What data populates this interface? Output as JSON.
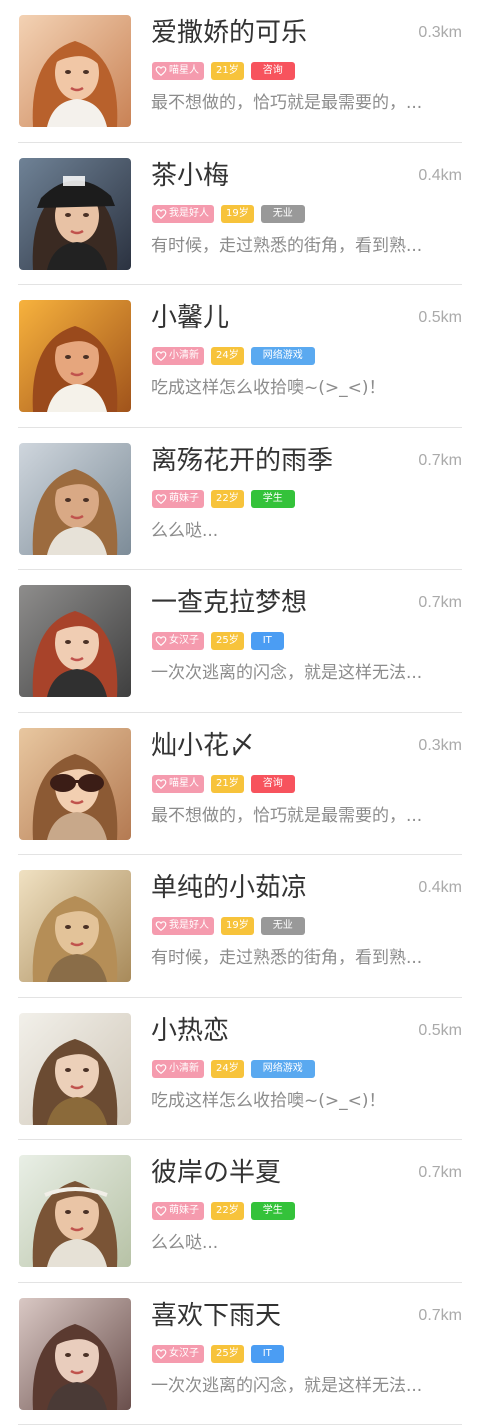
{
  "colors": {
    "persona_tag": "#f59bae",
    "age_tag": "#f7c33b",
    "name_text": "#333333",
    "distance_text": "#aaaaaa",
    "bio_text": "#8c8c8c",
    "divider": "#e3e3e3"
  },
  "profiles": [
    {
      "name": "爱撒娇的可乐",
      "distance": "0.3km",
      "persona_icon": "heart-outline-icon",
      "persona": "喵星人",
      "age": "21岁",
      "job": "咨询",
      "job_color": "#f7535d",
      "bio": "最不想做的，恰巧就是最需要的，...",
      "photo": "avatar-photo-red-hair-girl"
    },
    {
      "name": "茶小梅",
      "distance": "0.4km",
      "persona_icon": "heart-outline-icon",
      "persona": "我是好人",
      "age": "19岁",
      "job": "无业",
      "job_color": "#999999",
      "bio": "有时候，走过熟悉的街角，看到熟...",
      "photo": "avatar-photo-cap-girl"
    },
    {
      "name": "小馨儿",
      "distance": "0.5km",
      "persona_icon": "heart-outline-icon",
      "persona": "小清新",
      "age": "24岁",
      "job": "网络游戏",
      "job_color": "#5aa9f0",
      "bio": "吃成这样怎么收拾噢~(>_<)！",
      "photo": "avatar-photo-sunset-girl"
    },
    {
      "name": "离殇花开的雨季",
      "distance": "0.7km",
      "persona_icon": "heart-outline-icon",
      "persona": "萌妹子",
      "age": "22岁",
      "job": "学生",
      "job_color": "#34c23a",
      "bio": "么么哒...",
      "photo": "avatar-photo-freckles-girl"
    },
    {
      "name": "一查克拉梦想",
      "distance": "0.7km",
      "persona_icon": "heart-outline-icon",
      "persona": "女汉子",
      "age": "25岁",
      "job": "IT",
      "job_color": "#4b9df3",
      "bio": "一次次逃离的闪念，就是这样无法...",
      "photo": "avatar-photo-windy-red-hair"
    },
    {
      "name": "灿小花〆",
      "distance": "0.3km",
      "persona_icon": "heart-outline-icon",
      "persona": "喵星人",
      "age": "21岁",
      "job": "咨询",
      "job_color": "#f7535d",
      "bio": "最不想做的，恰巧就是最需要的，...",
      "photo": "avatar-photo-sunglasses-girl"
    },
    {
      "name": "单纯的小茹凉",
      "distance": "0.4km",
      "persona_icon": "heart-outline-icon",
      "persona": "我是好人",
      "age": "19岁",
      "job": "无业",
      "job_color": "#999999",
      "bio": "有时候，走过熟悉的街角，看到熟...",
      "photo": "avatar-photo-sepia-girl"
    },
    {
      "name": "小热恋",
      "distance": "0.5km",
      "persona_icon": "heart-outline-icon",
      "persona": "小清新",
      "age": "24岁",
      "job": "网络游戏",
      "job_color": "#5aa9f0",
      "bio": "吃成这样怎么收拾噢~(>_<)！",
      "photo": "avatar-photo-brunette-girl"
    },
    {
      "name": "彼岸の半夏",
      "distance": "0.7km",
      "persona_icon": "heart-outline-icon",
      "persona": "萌妹子",
      "age": "22岁",
      "job": "学生",
      "job_color": "#34c23a",
      "bio": "么么哒...",
      "photo": "avatar-photo-headband-girl"
    },
    {
      "name": "喜欢下雨天",
      "distance": "0.7km",
      "persona_icon": "heart-outline-icon",
      "persona": "女汉子",
      "age": "25岁",
      "job": "IT",
      "job_color": "#4b9df3",
      "bio": "一次次逃离的闪念，就是这样无法...",
      "photo": "avatar-photo-messy-hair-girl"
    }
  ]
}
